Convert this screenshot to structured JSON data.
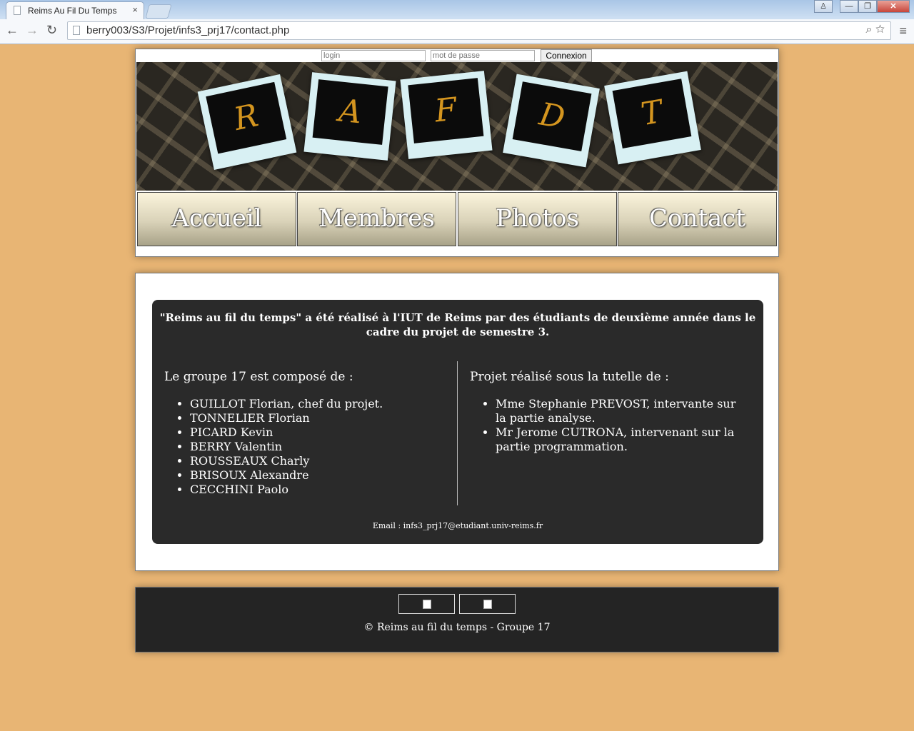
{
  "browser": {
    "tab_title": "Reims Au Fil Du Temps",
    "tab_close": "×",
    "url": "berry003/S3/Projet/infs3_prj17/contact.php",
    "back": "←",
    "forward": "→",
    "reload": "↻",
    "search_icon": "⌕",
    "star_icon": "☆",
    "menu_icon": "≡",
    "win_user": "♙",
    "win_min": "—",
    "win_max": "❐",
    "win_close": "✕"
  },
  "login": {
    "login_placeholder": "login",
    "password_placeholder": "mot de passe",
    "button": "Connexion"
  },
  "banner_letters": [
    "R",
    "A",
    "F",
    "D",
    "T"
  ],
  "menu": [
    "Accueil",
    "Membres",
    "Photos",
    "Contact"
  ],
  "content": {
    "intro": "\"Reims au fil du temps\" a été réalisé à l'IUT de Reims par des étudiants de deuxième année dans le cadre du projet de semestre 3.",
    "group_heading": "Le groupe 17 est composé de :",
    "members": [
      "GUILLOT Florian, chef du projet.",
      "TONNELIER Florian",
      "PICARD Kevin",
      "BERRY Valentin",
      "ROUSSEAUX Charly",
      "BRISOUX Alexandre",
      "CECCHINI Paolo"
    ],
    "tutors_heading": "Projet réalisé sous la tutelle de :",
    "tutors": [
      "Mme Stephanie PREVOST, intervante sur la partie analyse.",
      "Mr Jerome CUTRONA, intervenant sur la partie programmation."
    ],
    "email": "Email : infs3_prj17@etudiant.univ-reims.fr"
  },
  "footer": {
    "copyright": "© Reims au fil du temps - Groupe 17"
  }
}
